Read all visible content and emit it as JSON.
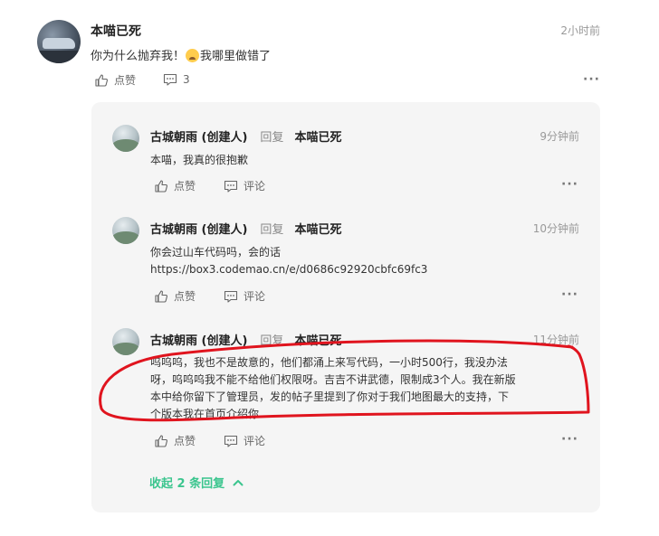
{
  "main_comment": {
    "author": "本喵已死",
    "time": "2小时前",
    "text_before_emoji": "你为什么抛弃我！",
    "emoji": "crying-face-emoji",
    "text_after_emoji": "我哪里做错了",
    "like_label": "点赞",
    "comment_count": "3",
    "more_label": "···"
  },
  "replies": [
    {
      "author": "古城朝雨 (创建人)",
      "reply_word": "回复",
      "target": "本喵已死",
      "time": "9分钟前",
      "text": "本喵，我真的很抱歉",
      "like_label": "点赞",
      "comment_label": "评论",
      "more_label": "···"
    },
    {
      "author": "古城朝雨 (创建人)",
      "reply_word": "回复",
      "target": "本喵已死",
      "time": "10分钟前",
      "text_line1": "你会过山车代码吗，会的话",
      "text_line2": "https://box3.codemao.cn/e/d0686c92920cbfc69fc3",
      "like_label": "点赞",
      "comment_label": "评论",
      "more_label": "···"
    },
    {
      "author": "古城朝雨 (创建人)",
      "reply_word": "回复",
      "target": "本喵已死",
      "time": "11分钟前",
      "text_line1": "呜呜呜，我也不是故意的，他们都涌上来写代码，一小时500行，我没办法",
      "text_line2": "呀，呜呜呜我不能不给他们权限呀。吉吉不讲武德，限制成3个人。我在新版",
      "text_line3": "本中给你留下了管理员，发的帖子里提到了你对于我们地图最大的支持，下",
      "text_line4": "个版本我在首页介绍你",
      "like_label": "点赞",
      "comment_label": "评论",
      "more_label": "···"
    }
  ],
  "collapse_label": "收起 2 条回复",
  "colors": {
    "accent_green": "#3bc58e",
    "annotation_red": "#e0141e",
    "reply_bg": "#f5f5f5"
  }
}
